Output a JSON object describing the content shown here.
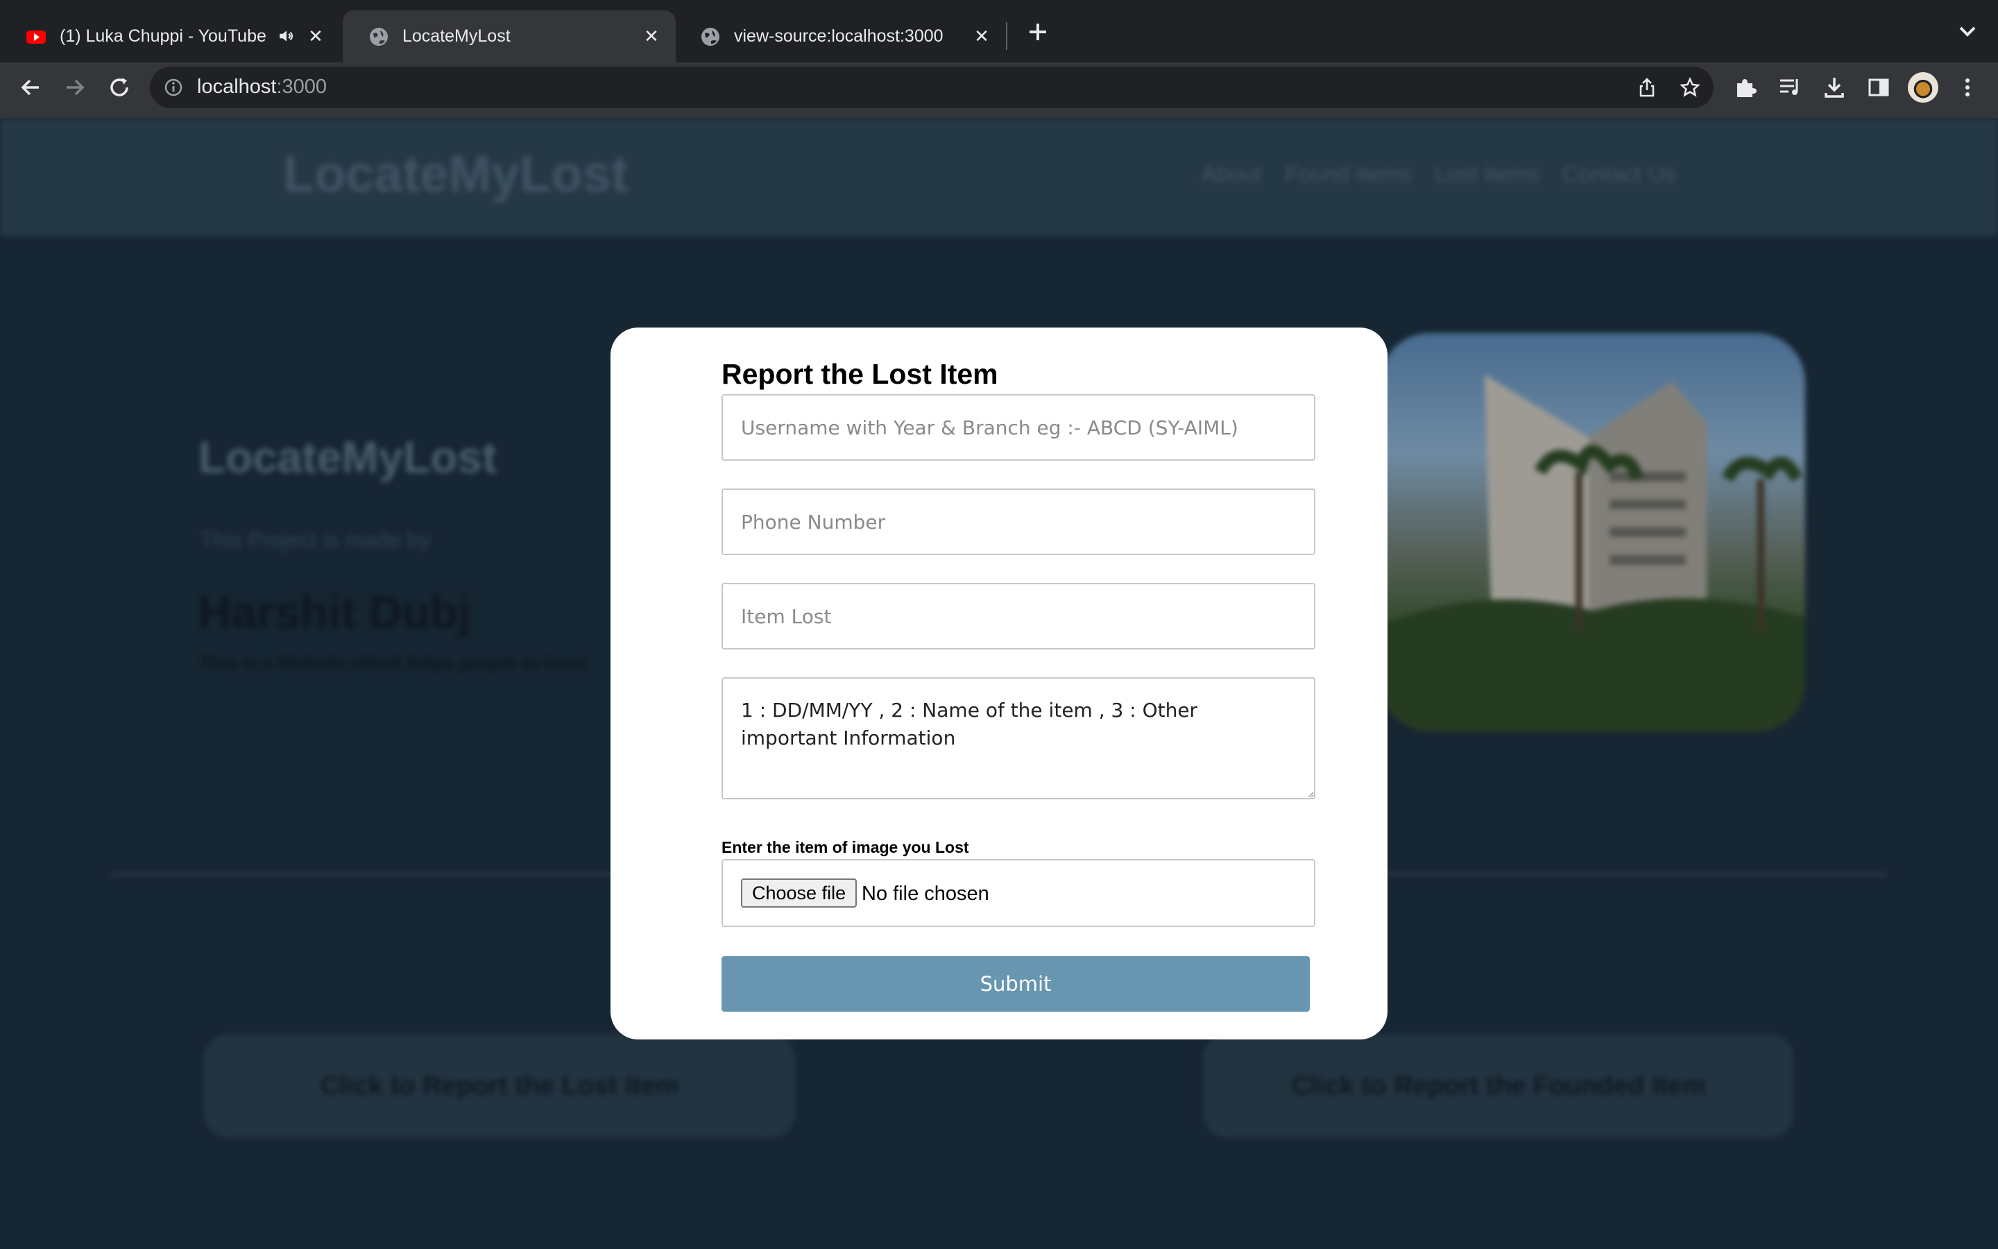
{
  "browser": {
    "tabs": [
      {
        "title": "(1) Luka Chuppi - YouTube",
        "favicon": "youtube-icon",
        "audio": true,
        "active": false
      },
      {
        "title": "LocateMyLost",
        "favicon": "globe-icon",
        "active": true
      },
      {
        "title": "view-source:localhost:3000",
        "favicon": "globe-icon",
        "active": false
      }
    ],
    "address": {
      "host": "localhost",
      "port": ":3000"
    }
  },
  "site": {
    "logo": "LocateMyLost",
    "nav": [
      "About",
      "Found items",
      "Lost items",
      "Contact Us"
    ],
    "hero": {
      "title": "LocateMyLost",
      "by_line": "This Project is made by",
      "author": "Harshit Dubj",
      "description": "This is a Website which helps people to locat"
    },
    "cta_lost": "Click to Report the Lost Item",
    "cta_found": "Click to Report the Founded Item"
  },
  "modal": {
    "title": "Report the Lost Item",
    "username_placeholder": "Username with Year & Branch eg :- ABCD (SY-AIML)",
    "phone_placeholder": "Phone Number",
    "item_placeholder": "Item Lost",
    "details_placeholder": "1 : DD/MM/YY , 2 : Name of the item , 3 : Other important Information",
    "file_label": "Enter the item of image you Lost",
    "choose_file": "Choose file",
    "file_status": "No file chosen",
    "submit": "Submit"
  },
  "colors": {
    "page_bg": "#1b2c3a",
    "submit_bg": "#6896b1",
    "modal_bg": "#ffffff"
  }
}
